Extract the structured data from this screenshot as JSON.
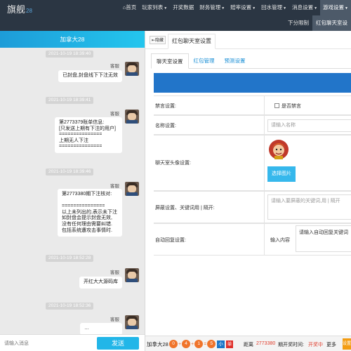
{
  "brand": {
    "name": "旗舰",
    "version": "28"
  },
  "nav": {
    "home_icon": "⌂",
    "items": [
      {
        "label": "首页",
        "active": false,
        "caret": false
      },
      {
        "label": "玩家列表",
        "active": false,
        "caret": true
      },
      {
        "label": "开奖数据",
        "active": false,
        "caret": false
      },
      {
        "label": "财务管理",
        "active": false,
        "caret": true
      },
      {
        "label": "赔率设置",
        "active": false,
        "caret": true
      },
      {
        "label": "回水管理",
        "active": false,
        "caret": true
      },
      {
        "label": "消息设置",
        "active": false,
        "caret": true
      },
      {
        "label": "游戏设置",
        "active": true,
        "caret": true
      }
    ]
  },
  "subnav": {
    "items": [
      {
        "label": "下分限制",
        "active": false
      },
      {
        "label": "红包聊天室设",
        "active": true
      }
    ]
  },
  "chat": {
    "title": "加拿大28",
    "input_placeholder": "请输入消息",
    "send_label": "发送",
    "messages": [
      {
        "time": "2021-10-19 18:39:40",
        "sender": "客服",
        "text": "已封盘,封盘线下下注无效"
      },
      {
        "time": "2021-10-19 18:39:41",
        "sender": "客服",
        "text": "第2773379账单信息:\n[只发送上期有下注的用户]\n===============\n上期无人下注\n==============="
      },
      {
        "time": "2021-10-19 18:39:46",
        "sender": "客服",
        "text": "第2773380期下注核对:\n\n===============\n以上未列出的,表示未下注\n如封盘会提示封盘无效,\n没有任何理由需要纠错.\n包括系统遭攻击事情时."
      },
      {
        "time": "2021-10-19 18:52:28",
        "sender": "客服",
        "text": "开红大大源码库"
      },
      {
        "time": "2021-10-19 18:52:36",
        "sender": "客服",
        "text": "…"
      }
    ]
  },
  "panel": {
    "hide_icon": "⇤",
    "hide_label": "隐藏",
    "page_tab": "红包聊天室设置",
    "tabs": [
      {
        "label": "聊天室设置",
        "active": true
      },
      {
        "label": "红包管理",
        "active": false
      },
      {
        "label": "预测设置",
        "active": false
      }
    ],
    "form": {
      "mute_label": "禁言设置:",
      "mute_checkbox_label": "是否禁言",
      "nickname_label": "名称设置:",
      "nickname_placeholder": "请输入名称",
      "avatar_label": "聊天室头像设置:",
      "choose_image_label": "选择图片",
      "filter_label": "屏蔽设置、关键词用 | 隔开:",
      "filter_placeholder": "请输入要屏蔽的关键词,用 | 隔开",
      "autoreply_label": "自动回复设置:",
      "autoreply_input_label": "输入内容",
      "autoreply_placeholder": "请输入自动回复关键词"
    }
  },
  "status": {
    "room": "加拿大28",
    "balls": [
      "0",
      "4",
      "1",
      "5"
    ],
    "ball_ops": [
      "+",
      "+",
      "="
    ],
    "result_tags": [
      "小",
      "单"
    ],
    "countdown_prefix": "距离",
    "period": "2773380",
    "countdown_suffix": "期开奖时间:",
    "state": "开奖中",
    "more": "更多",
    "settings_button": "设置",
    "colors": {
      "ball": "#f0742b",
      "tag_small": "#1a75c8",
      "tag_odd": "#e0302b",
      "period": "#e03c2b",
      "state": "#e03c2b"
    }
  }
}
